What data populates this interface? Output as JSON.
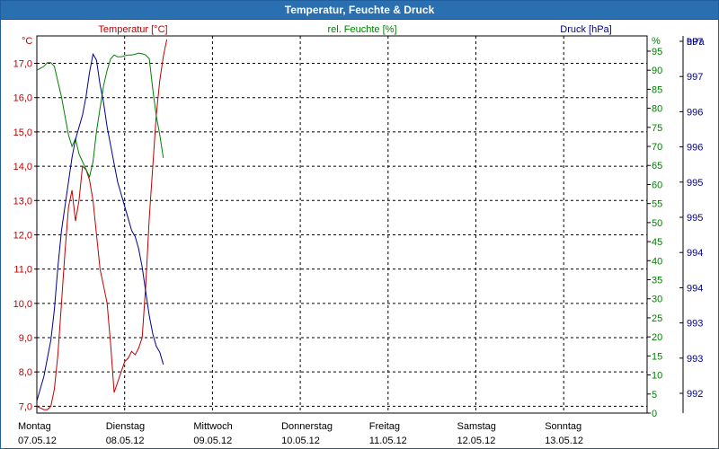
{
  "window": {
    "title": "Temperatur, Feuchte & Druck"
  },
  "chart_data": {
    "type": "line",
    "title": "Temperatur, Feuchte & Druck",
    "grid": true,
    "x_days": [
      {
        "day": "Montag",
        "date": "07.05.12"
      },
      {
        "day": "Dienstag",
        "date": "08.05.12"
      },
      {
        "day": "Mittwoch",
        "date": "09.05.12"
      },
      {
        "day": "Donnerstag",
        "date": "10.05.12"
      },
      {
        "day": "Freitag",
        "date": "11.05.12"
      },
      {
        "day": "Samstag",
        "date": "12.05.12"
      },
      {
        "day": "Sonntag",
        "date": "13.05.12"
      }
    ],
    "axes": {
      "temperature": {
        "label": "Temperatur [°C]",
        "unit": "°C",
        "color": "#c00000",
        "ylim": [
          6.8,
          17.8
        ],
        "ticks": [
          "7,0",
          "8,0",
          "9,0",
          "10,0",
          "11,0",
          "12,0",
          "13,0",
          "14,0",
          "15,0",
          "16,0",
          "17,0"
        ]
      },
      "humidity": {
        "label": "rel. Feuchte [%]",
        "unit": "%",
        "color": "#008000",
        "ylim": [
          0,
          99
        ],
        "ticks": [
          "0",
          "5",
          "10",
          "15",
          "20",
          "25",
          "30",
          "35",
          "40",
          "45",
          "50",
          "55",
          "60",
          "65",
          "70",
          "75",
          "80",
          "85",
          "90",
          "95"
        ]
      },
      "pressure": {
        "label": "Druck [hPa]",
        "unit": "hPa",
        "color": "#000090",
        "ylim": [
          991.6,
          997.8
        ],
        "ticks": [
          "992",
          "993",
          "993",
          "994",
          "994",
          "995",
          "995",
          "996",
          "996",
          "997",
          "997"
        ]
      }
    },
    "series": [
      {
        "name": "Temperatur [°C]",
        "axis": "temperature",
        "color": "#c00000",
        "x": [
          0.0,
          0.04,
          0.08,
          0.12,
          0.16,
          0.2,
          0.24,
          0.28,
          0.32,
          0.36,
          0.4,
          0.44,
          0.48,
          0.52,
          0.56,
          0.6,
          0.64,
          0.68,
          0.72,
          0.76,
          0.8,
          0.84,
          0.88,
          0.92,
          0.96,
          1.0,
          1.04,
          1.08,
          1.12,
          1.16,
          1.2,
          1.24,
          1.28,
          1.32,
          1.36,
          1.4,
          1.44,
          1.48
        ],
        "values": [
          7.0,
          6.95,
          6.9,
          6.9,
          7.0,
          7.5,
          8.5,
          10.0,
          11.5,
          12.8,
          13.3,
          12.4,
          13.0,
          14.0,
          13.9,
          13.6,
          13.0,
          12.0,
          11.0,
          10.5,
          10.0,
          8.8,
          7.4,
          7.7,
          8.0,
          8.3,
          8.4,
          8.6,
          8.5,
          8.7,
          9.0,
          10.5,
          12.5,
          14.0,
          15.5,
          16.5,
          17.2,
          17.7
        ]
      },
      {
        "name": "rel. Feuchte [%]",
        "axis": "humidity",
        "color": "#008000",
        "x": [
          0.0,
          0.04,
          0.08,
          0.12,
          0.16,
          0.2,
          0.24,
          0.28,
          0.32,
          0.36,
          0.4,
          0.44,
          0.48,
          0.52,
          0.56,
          0.6,
          0.64,
          0.68,
          0.72,
          0.76,
          0.8,
          0.84,
          0.88,
          0.92,
          0.96,
          1.0,
          1.04,
          1.08,
          1.12,
          1.16,
          1.2,
          1.24,
          1.28,
          1.32,
          1.36,
          1.4,
          1.44
        ],
        "values": [
          90,
          90.5,
          91,
          92,
          92,
          91,
          87,
          83,
          78,
          73,
          70,
          72,
          68,
          66,
          64,
          62,
          66,
          74,
          80,
          86,
          90,
          93,
          94,
          93.5,
          93.5,
          93.8,
          94,
          94,
          94.2,
          94.5,
          94.3,
          94,
          93,
          85,
          78,
          73,
          67
        ]
      },
      {
        "name": "Druck [hPa]",
        "axis": "pressure",
        "color": "#000090",
        "x": [
          0.0,
          0.04,
          0.08,
          0.12,
          0.16,
          0.2,
          0.24,
          0.28,
          0.32,
          0.36,
          0.4,
          0.44,
          0.48,
          0.52,
          0.56,
          0.6,
          0.64,
          0.68,
          0.72,
          0.76,
          0.8,
          0.84,
          0.88,
          0.92,
          0.96,
          1.0,
          1.04,
          1.08,
          1.12,
          1.16,
          1.2,
          1.24,
          1.28,
          1.32,
          1.36,
          1.4,
          1.44
        ],
        "values": [
          991.8,
          992.0,
          992.2,
          992.5,
          992.8,
          993.3,
          994.0,
          994.6,
          995.0,
          995.4,
          995.8,
          996.1,
          996.3,
          996.5,
          996.8,
          997.2,
          997.5,
          997.4,
          997.0,
          996.7,
          996.3,
          996.0,
          995.7,
          995.4,
          995.2,
          995.0,
          994.8,
          994.6,
          994.5,
          994.3,
          994.0,
          993.6,
          993.2,
          992.9,
          992.7,
          992.6,
          992.4
        ]
      }
    ]
  }
}
